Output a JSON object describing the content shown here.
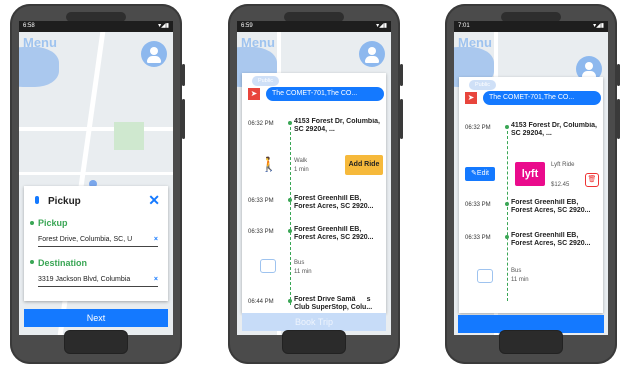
{
  "phones": [
    {
      "status_time": "6:58",
      "status_icons": "▾◢▮",
      "menu_label": "Menu",
      "card": {
        "title": "Pickup",
        "pickup_label": "Pickup",
        "pickup_value": "Forest Drive, Columbia, SC, U",
        "destination_label": "Destination",
        "destination_value": "3319 Jackson Blvd, Columbia"
      },
      "next_label": "Next"
    },
    {
      "status_time": "6:59",
      "status_icons": "▾◢▮",
      "menu_label": "Menu",
      "public_label": "Public",
      "route_label": "The COMET-701,The CO...",
      "items": [
        {
          "time": "06:32 PM",
          "stop": "4153 Forest Dr, Columbia, SC 29204, ..."
        },
        {
          "mode": "Walk",
          "duration": "1 min",
          "action": "Add Ride"
        },
        {
          "time": "06:33 PM",
          "stop": "Forest Greenhill EB, Forest Acres, SC 2920..."
        },
        {
          "time": "06:33 PM",
          "stop": "Forest Greenhill EB, Forest Acres, SC 2920..."
        },
        {
          "mode": "Bus",
          "duration": "11 min"
        },
        {
          "time": "06:44 PM",
          "stop": "Forest Drive Samâs Club SuperStop, Colu..."
        }
      ],
      "book_label": "Book Trip"
    },
    {
      "status_time": "7:01",
      "status_icons": "▾◢▮",
      "menu_label": "Menu",
      "public_label": "Public",
      "route_label": "The COMET-701,The CO...",
      "items": [
        {
          "time": "06:32 PM",
          "stop": "4153 Forest Dr, Columbia, SC 29204, ..."
        },
        {
          "edit": "Edit",
          "ride_label": "Lyft Ride",
          "price": "$12.45",
          "logo": "lyft"
        },
        {
          "time": "06:33 PM",
          "stop": "Forest Greenhill EB, Forest Acres, SC 2920..."
        },
        {
          "time": "06:33 PM",
          "stop": "Forest Greenhill EB, Forest Acres, SC 2920..."
        },
        {
          "mode": "Bus",
          "duration": "11 min"
        }
      ]
    }
  ],
  "colors": {
    "accent": "#1479ff",
    "green": "#3aa655",
    "add_ride": "#f6b93b",
    "lyft": "#ea0b8c"
  }
}
